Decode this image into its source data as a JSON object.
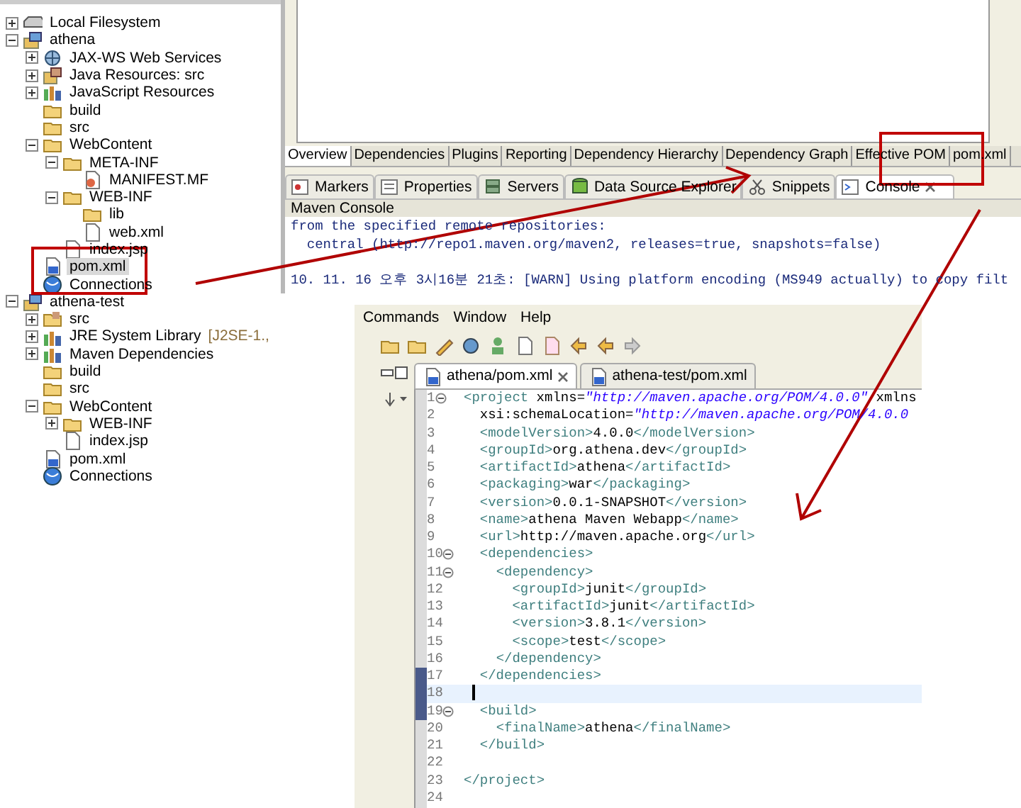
{
  "project_tree": [
    {
      "label": "Local Filesystem",
      "kind": "drive",
      "expanded": false,
      "selected": false
    },
    {
      "label": "athena",
      "kind": "project",
      "expanded": true,
      "selected": false,
      "children": [
        {
          "label": "JAX-WS Web Services",
          "kind": "services",
          "expanded": false,
          "selected": false
        },
        {
          "label": "Java Resources: src",
          "kind": "java",
          "expanded": false,
          "selected": false
        },
        {
          "label": "JavaScript Resources",
          "kind": "library",
          "expanded": false,
          "selected": false
        },
        {
          "label": "build",
          "kind": "folder",
          "selected": false
        },
        {
          "label": "src",
          "kind": "folder",
          "selected": false
        },
        {
          "label": "WebContent",
          "kind": "folder",
          "expanded": true,
          "selected": false,
          "children": [
            {
              "label": "META-INF",
              "kind": "folder",
              "expanded": true,
              "selected": false,
              "children": [
                {
                  "label": "MANIFEST.MF",
                  "kind": "manifest",
                  "selected": false
                }
              ]
            },
            {
              "label": "WEB-INF",
              "kind": "folder",
              "expanded": true,
              "selected": false,
              "children": [
                {
                  "label": "lib",
                  "kind": "folder",
                  "selected": false
                },
                {
                  "label": "web.xml",
                  "kind": "file",
                  "selected": false
                }
              ]
            },
            {
              "label": "index.jsp",
              "kind": "file",
              "selected": false
            }
          ]
        },
        {
          "label": "pom.xml",
          "kind": "maven",
          "selected": true
        },
        {
          "label": "Connections",
          "kind": "connections",
          "selected": false
        }
      ]
    },
    {
      "label": "athena-test",
      "kind": "project",
      "expanded": true,
      "selected": false,
      "children": [
        {
          "label": "src",
          "kind": "source",
          "expanded": false,
          "selected": false
        },
        {
          "label": "JRE System Library",
          "decoration": "[J2SE-1.,",
          "kind": "library",
          "expanded": false,
          "selected": false
        },
        {
          "label": "Maven Dependencies",
          "kind": "library",
          "expanded": false,
          "selected": false
        },
        {
          "label": "build",
          "kind": "folder",
          "selected": false
        },
        {
          "label": "src",
          "kind": "folder",
          "selected": false
        },
        {
          "label": "WebContent",
          "kind": "folder",
          "expanded": true,
          "selected": false,
          "children": [
            {
              "label": "WEB-INF",
              "kind": "folder",
              "expanded": false,
              "selected": false
            },
            {
              "label": "index.jsp",
              "kind": "file",
              "selected": false
            }
          ]
        },
        {
          "label": "pom.xml",
          "kind": "maven",
          "selected": false
        },
        {
          "label": "Connections",
          "kind": "connections",
          "selected": false
        }
      ]
    }
  ],
  "pom_editor_tabs": [
    {
      "label": "Overview",
      "selected": true
    },
    {
      "label": "Dependencies",
      "selected": false
    },
    {
      "label": "Plugins",
      "selected": false
    },
    {
      "label": "Reporting",
      "selected": false
    },
    {
      "label": "Dependency Hierarchy",
      "selected": false
    },
    {
      "label": "Dependency Graph",
      "selected": false
    },
    {
      "label": "Effective POM",
      "selected": false
    },
    {
      "label": "pom.xml",
      "selected": false
    }
  ],
  "view_tabs": [
    {
      "label": "Markers",
      "kind": "markers",
      "selected": false
    },
    {
      "label": "Properties",
      "kind": "properties",
      "selected": false
    },
    {
      "label": "Servers",
      "kind": "servers",
      "selected": false
    },
    {
      "label": "Data Source Explorer",
      "kind": "datasource",
      "selected": false
    },
    {
      "label": "Snippets",
      "kind": "snippets",
      "selected": false
    },
    {
      "label": "Console",
      "kind": "console",
      "selected": true
    }
  ],
  "console": {
    "title": "Maven Console",
    "lines": [
      "from the specified remote repositories:",
      "  central (http://repo1.maven.org/maven2, releases=true, snapshots=false)"
    ],
    "log_entry": "10. 11. 16 오후 3시16분 21초: [WARN] Using platform encoding (MS949 actually) to copy filt"
  },
  "menu": [
    "Commands",
    "Window",
    "Help"
  ],
  "editor_tabs": [
    {
      "label": "athena/pom.xml",
      "selected": true
    },
    {
      "label": "athena-test/pom.xml",
      "selected": false
    }
  ],
  "code_lines": [
    {
      "number": "1",
      "fold": true,
      "current": false,
      "text": "<project xmlns=\"http://maven.apache.org/POM/4.0.0\" xmlns"
    },
    {
      "number": "2",
      "fold": false,
      "current": false,
      "text": "  xsi:schemaLocation=\"http://maven.apache.org/POM/4.0.0"
    },
    {
      "number": "3",
      "fold": false,
      "current": false,
      "text": "  <modelVersion>4.0.0</modelVersion>"
    },
    {
      "number": "4",
      "fold": false,
      "current": false,
      "text": "  <groupId>org.athena.dev</groupId>"
    },
    {
      "number": "5",
      "fold": false,
      "current": false,
      "text": "  <artifactId>athena</artifactId>"
    },
    {
      "number": "6",
      "fold": false,
      "current": false,
      "text": "  <packaging>war</packaging>"
    },
    {
      "number": "7",
      "fold": false,
      "current": false,
      "text": "  <version>0.0.1-SNAPSHOT</version>"
    },
    {
      "number": "8",
      "fold": false,
      "current": false,
      "text": "  <name>athena Maven Webapp</name>"
    },
    {
      "number": "9",
      "fold": false,
      "current": false,
      "text": "  <url>http://maven.apache.org</url>"
    },
    {
      "number": "10",
      "fold": true,
      "current": false,
      "text": "  <dependencies>"
    },
    {
      "number": "11",
      "fold": true,
      "current": false,
      "text": "    <dependency>"
    },
    {
      "number": "12",
      "fold": false,
      "current": false,
      "text": "      <groupId>junit</groupId>"
    },
    {
      "number": "13",
      "fold": false,
      "current": false,
      "text": "      <artifactId>junit</artifactId>"
    },
    {
      "number": "14",
      "fold": false,
      "current": false,
      "text": "      <version>3.8.1</version>"
    },
    {
      "number": "15",
      "fold": false,
      "current": false,
      "text": "      <scope>test</scope>"
    },
    {
      "number": "16",
      "fold": false,
      "current": false,
      "text": "    </dependency>"
    },
    {
      "number": "17",
      "fold": false,
      "current": false,
      "text": "  </dependencies>"
    },
    {
      "number": "18",
      "fold": false,
      "current": true
    },
    {
      "number": "19",
      "fold": true,
      "current": false,
      "text": "  <build>"
    },
    {
      "number": "20",
      "fold": false,
      "current": false,
      "text": "    <finalName>athena</finalName>"
    },
    {
      "number": "21",
      "fold": false,
      "current": false,
      "text": "  </build>"
    },
    {
      "number": "22",
      "fold": false,
      "current": false
    },
    {
      "number": "23",
      "fold": false,
      "current": false,
      "text": "</project>"
    },
    {
      "number": "24",
      "fold": false,
      "current": false
    }
  ]
}
